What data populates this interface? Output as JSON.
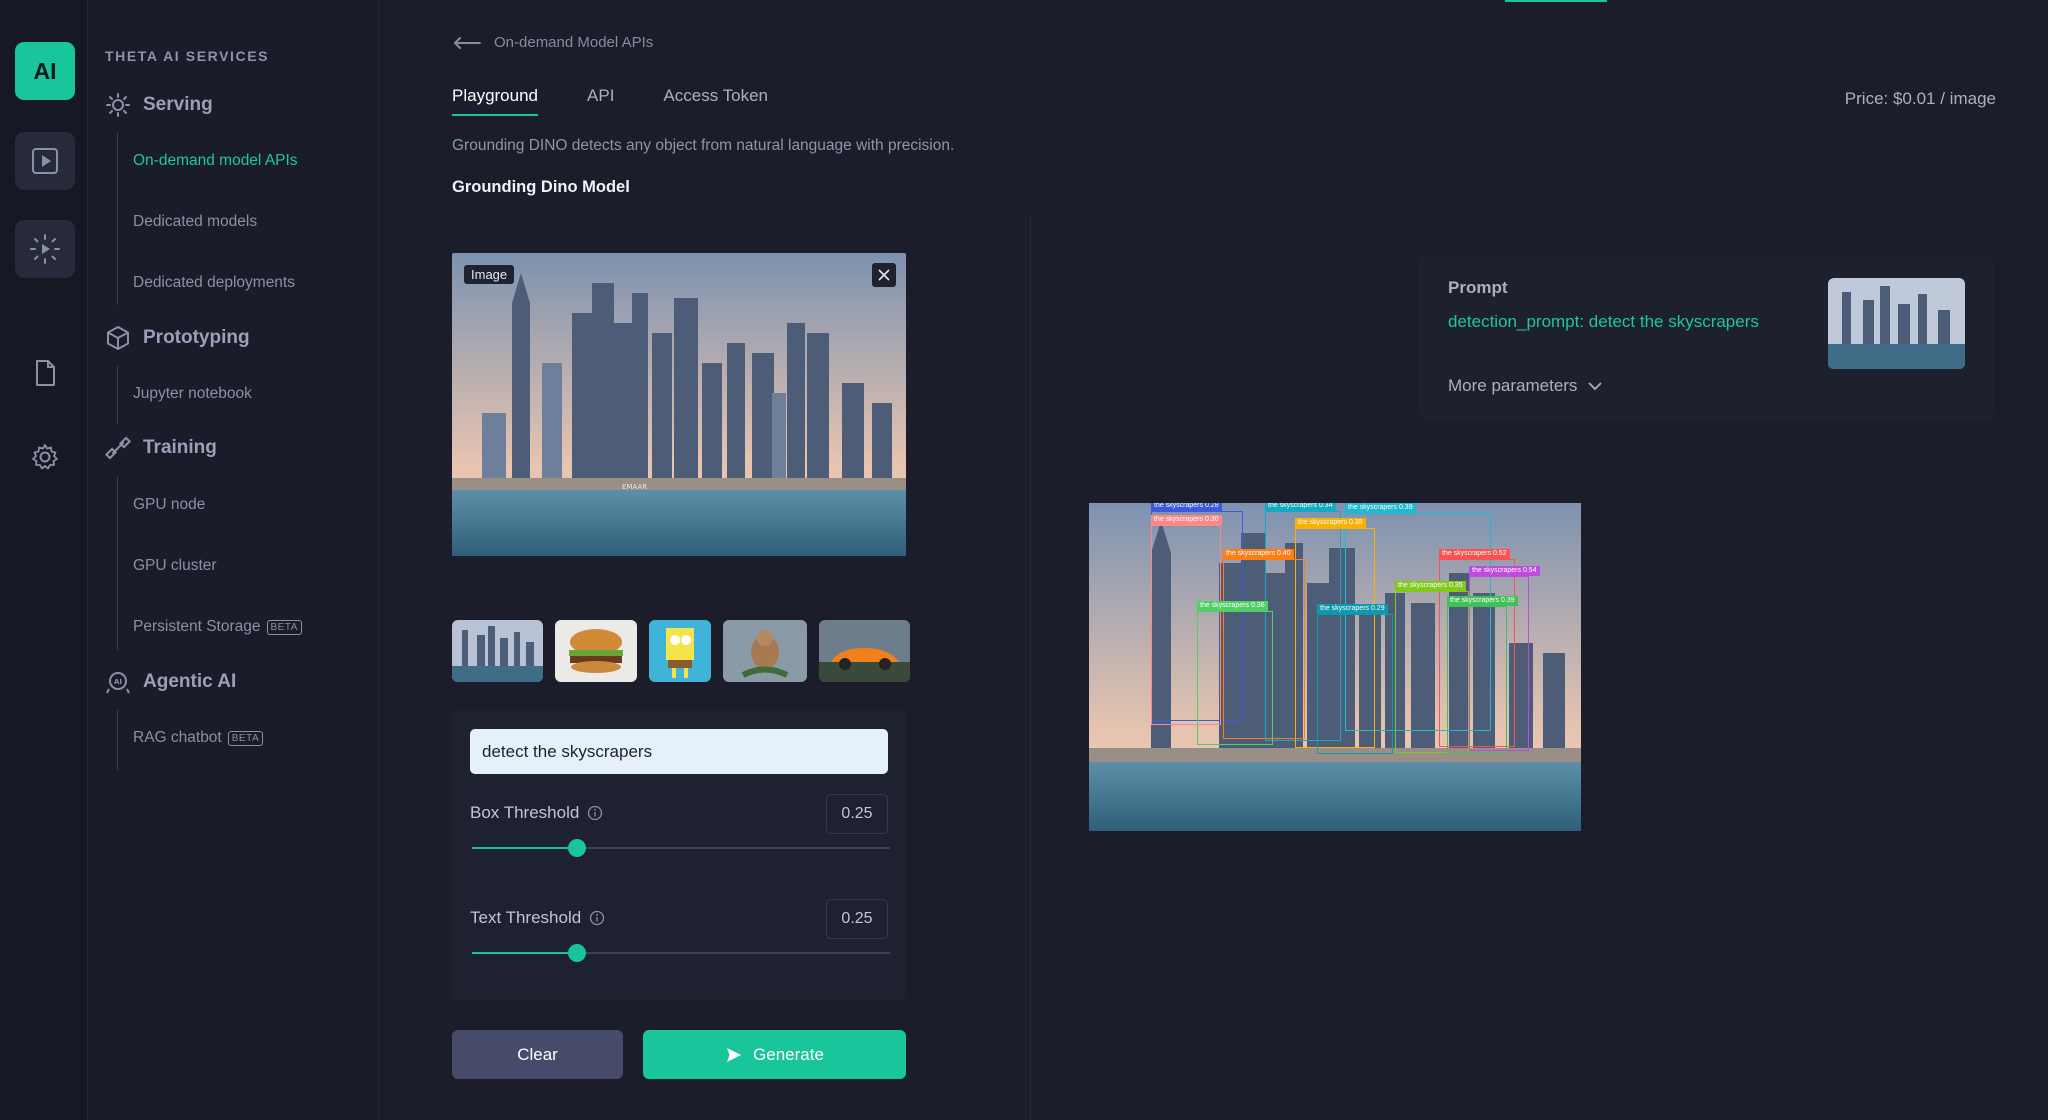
{
  "rail": {
    "logo": "AI"
  },
  "sidebar": {
    "title": "THETA AI SERVICES",
    "groups": {
      "serving": "Serving",
      "prototyping": "Prototyping",
      "training": "Training",
      "agentic": "Agentic AI"
    },
    "items": {
      "on_demand": "On-demand model APIs",
      "dedicated_models": "Dedicated models",
      "dedicated_deployments": "Dedicated deployments",
      "jupyter": "Jupyter notebook",
      "gpu_node": "GPU node",
      "gpu_cluster": "GPU cluster",
      "persistent_storage": "Persistent Storage",
      "rag_chatbot": "RAG chatbot",
      "beta": "BETA"
    }
  },
  "breadcrumb": "On-demand Model APIs",
  "tabs": [
    "Playground",
    "API",
    "Access Token"
  ],
  "price": "Price: $0.01 / image",
  "description": "Grounding DINO detects any object from natural language with precision.",
  "model_title": "Grounding Dino Model",
  "image_tag": "Image",
  "input_image_caption": "EMAAR",
  "form": {
    "prompt_value": "detect the skyscrapers",
    "box_threshold_label": "Box Threshold",
    "box_threshold_value": "0.25",
    "box_threshold_fraction": 0.25,
    "text_threshold_label": "Text Threshold",
    "text_threshold_value": "0.25",
    "text_threshold_fraction": 0.25
  },
  "buttons": {
    "clear": "Clear",
    "generate": "Generate"
  },
  "result": {
    "prompt_label": "Prompt",
    "prompt_text": "detection_prompt: detect the skyscrapers",
    "more_params": "More parameters",
    "detections": [
      {
        "label": "the skyscrapers 0.28",
        "color": "#3b5bdb"
      },
      {
        "label": "the skyscrapers 0.30",
        "color": "#ff8787"
      },
      {
        "label": "the skyscrapers 0.34",
        "color": "#15aabf"
      },
      {
        "label": "the skyscrapers 0.39",
        "color": "#22b8cf"
      },
      {
        "label": "the skyscrapers 0.35",
        "color": "#fab005"
      },
      {
        "label": "the skyscrapers 0.40",
        "color": "#fd7e14"
      },
      {
        "label": "the skyscrapers 0.52",
        "color": "#fa5252"
      },
      {
        "label": "the skyscrapers 0.54",
        "color": "#be4bdb"
      },
      {
        "label": "the skyscrapers 0.35",
        "color": "#82c91e"
      },
      {
        "label": "the skyscrapers 0.39",
        "color": "#40c057"
      },
      {
        "label": "the skyscrapers 0.36",
        "color": "#51cf66"
      },
      {
        "label": "the skyscrapers 0.29",
        "color": "#1098ad"
      }
    ]
  },
  "colors": {
    "accent": "#19c59a",
    "background": "#1b1e2a"
  }
}
